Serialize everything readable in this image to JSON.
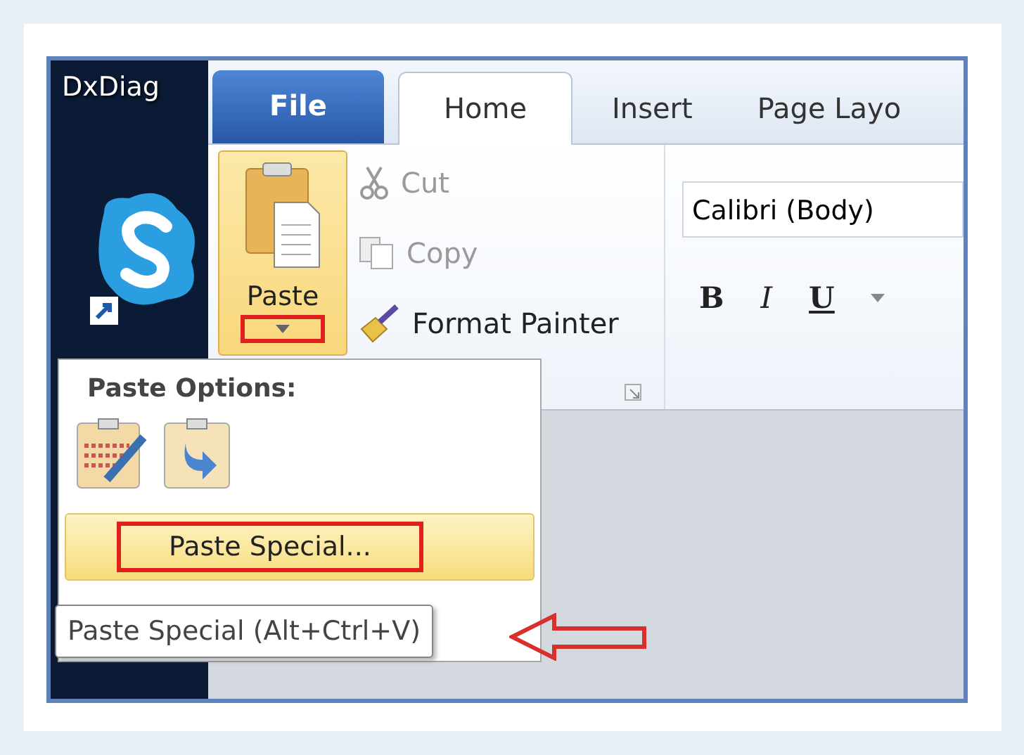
{
  "desktop": {
    "icon_label": "DxDiag"
  },
  "tabs": [
    {
      "label": "File",
      "kind": "file",
      "selected": false
    },
    {
      "label": "Home",
      "kind": "tab",
      "selected": true
    },
    {
      "label": "Insert",
      "kind": "tab",
      "selected": false
    },
    {
      "label": "Page Layo",
      "kind": "tab",
      "selected": false
    }
  ],
  "clipboard": {
    "paste_label": "Paste",
    "dropdown_marked": true,
    "commands": [
      {
        "label": "Cut",
        "kind": "cut",
        "disabled": true
      },
      {
        "label": "Copy",
        "kind": "copy",
        "disabled": true
      },
      {
        "label": "Format Painter",
        "kind": "painter",
        "disabled": false
      }
    ]
  },
  "font": {
    "name": "Calibri (Body)",
    "buttons": [
      {
        "label": "B",
        "kind": "bold"
      },
      {
        "label": "I",
        "kind": "italic"
      },
      {
        "label": "U",
        "kind": "underline"
      }
    ]
  },
  "paste_menu": {
    "title": "Paste Options:",
    "options": [
      {
        "kind": "keep-source"
      },
      {
        "kind": "text-only"
      }
    ],
    "item": {
      "label": "Paste Special...",
      "hovered": true,
      "marked": true
    },
    "tooltip": "Paste Special (Alt+Ctrl+V)"
  }
}
